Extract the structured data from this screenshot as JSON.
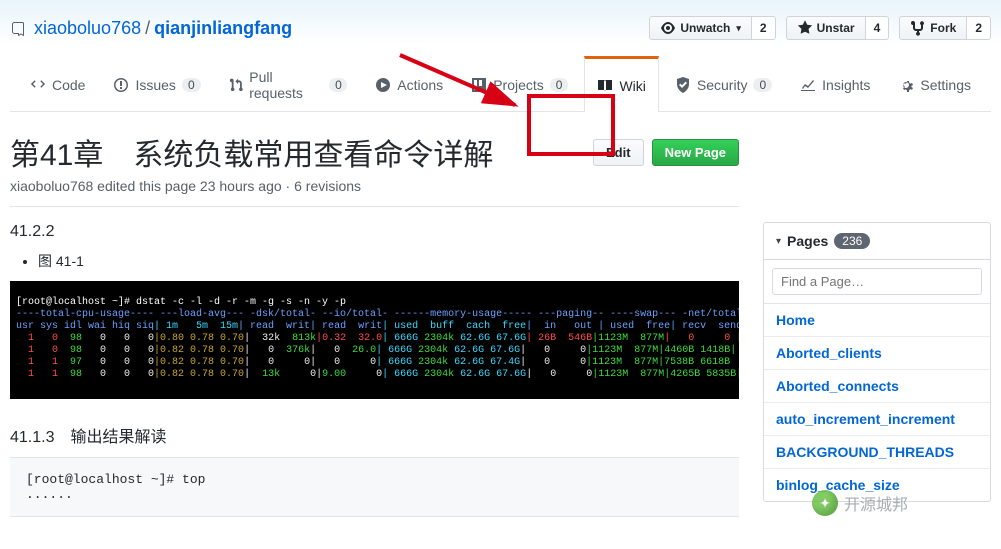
{
  "repo": {
    "owner": "xiaoboluo768",
    "name": "qianjinliangfang"
  },
  "repo_actions": {
    "watch": {
      "label": "Unwatch",
      "count": 2
    },
    "star": {
      "label": "Unstar",
      "count": 4
    },
    "fork": {
      "label": "Fork",
      "count": 2
    }
  },
  "tabs": {
    "code": {
      "label": "Code"
    },
    "issues": {
      "label": "Issues",
      "count": 0
    },
    "pulls": {
      "label": "Pull requests",
      "count": 0
    },
    "actions": {
      "label": "Actions"
    },
    "projects": {
      "label": "Projects",
      "count": 0
    },
    "wiki": {
      "label": "Wiki"
    },
    "security": {
      "label": "Security",
      "count": 0
    },
    "insights": {
      "label": "Insights"
    },
    "settings": {
      "label": "Settings"
    }
  },
  "wiki": {
    "title": "第41章　系统负载常用查看命令详解",
    "subtitle": "xiaoboluo768 edited this page 23 hours ago · 6 revisions",
    "edit_label": "Edit",
    "new_label": "New Page"
  },
  "sections": {
    "s1": "41.2.2",
    "fig": "图 41-1",
    "s2": "41.1.3　输出结果解读"
  },
  "terminal": {
    "prompt": "[root@localhost ~]# dstat -c -l -d -r -m -g -s -n -y -p"
  },
  "code": {
    "line1": "[root@localhost ~]# top",
    "line2": "......"
  },
  "sidebar": {
    "header": "Pages",
    "count": "236",
    "search_placeholder": "Find a Page…",
    "links": [
      "Home",
      "Aborted_clients",
      "Aborted_connects",
      "auto_increment_increment",
      "BACKGROUND_THREADS",
      "binlog_cache_size"
    ]
  },
  "watermark": "开源城邦"
}
